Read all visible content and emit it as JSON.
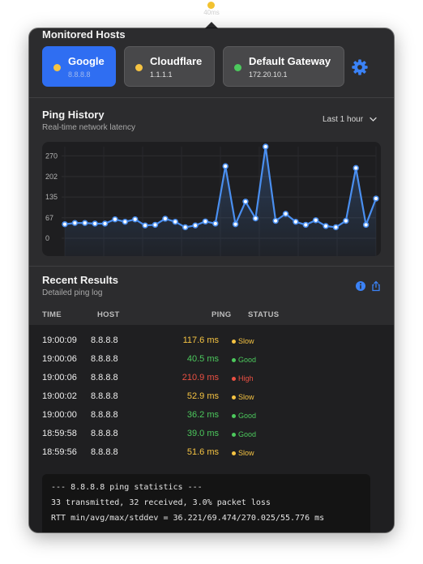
{
  "menubar": {
    "status_text": "40ms",
    "dot_color": "#f2c230"
  },
  "colors": {
    "accent": "#2f6ef2",
    "good": "#4cc95d",
    "slow": "#f5c342",
    "high": "#ec5043",
    "line": "#4a8ff0"
  },
  "hosts": {
    "title": "Monitored Hosts",
    "items": [
      {
        "name": "Google",
        "ip": "8.8.8.8",
        "status": "slow"
      },
      {
        "name": "Cloudflare",
        "ip": "1.1.1.1",
        "status": "slow"
      },
      {
        "name": "Default Gateway",
        "ip": "172.20.10.1",
        "status": "good"
      }
    ],
    "settings_icon": "gear-icon"
  },
  "history": {
    "title": "Ping History",
    "subtitle": "Real-time network latency",
    "range_label": "Last 1 hour",
    "range_icon": "chevron-down-icon"
  },
  "chart_data": {
    "type": "line",
    "title": "Ping History",
    "ylabel": "",
    "xlabel": "",
    "ylim": [
      0,
      300
    ],
    "y_ticks": [
      0,
      67,
      135,
      202,
      270
    ],
    "grid": true,
    "legend": "none",
    "series": [
      {
        "values": [
          46,
          50,
          50,
          48,
          48,
          62,
          54,
          62,
          42,
          44,
          64,
          54,
          36,
          42,
          55,
          48,
          236,
          46,
          120,
          65,
          300,
          57,
          80,
          54,
          44,
          59,
          40,
          36,
          57,
          230,
          44,
          130
        ]
      }
    ]
  },
  "results": {
    "title": "Recent Results",
    "subtitle": "Detailed ping log",
    "info_icon": "info-icon",
    "share_icon": "share-icon",
    "columns": {
      "time": "TIME",
      "host": "HOST",
      "ping": "PING",
      "status": "STATUS"
    },
    "rows": [
      {
        "time": "19:00:09",
        "host": "8.8.8.8",
        "ping": "117.6 ms",
        "status": "Slow",
        "level": "slow"
      },
      {
        "time": "19:00:06",
        "host": "8.8.8.8",
        "ping": "40.5 ms",
        "status": "Good",
        "level": "good"
      },
      {
        "time": "19:00:06",
        "host": "8.8.8.8",
        "ping": "210.9 ms",
        "status": "High",
        "level": "high"
      },
      {
        "time": "19:00:02",
        "host": "8.8.8.8",
        "ping": "52.9 ms",
        "status": "Slow",
        "level": "slow"
      },
      {
        "time": "19:00:00",
        "host": "8.8.8.8",
        "ping": "36.2 ms",
        "status": "Good",
        "level": "good"
      },
      {
        "time": "18:59:58",
        "host": "8.8.8.8",
        "ping": "39.0 ms",
        "status": "Good",
        "level": "good"
      },
      {
        "time": "18:59:56",
        "host": "8.8.8.8",
        "ping": "51.6 ms",
        "status": "Slow",
        "level": "slow"
      }
    ]
  },
  "terminal": {
    "lines": [
      "--- 8.8.8.8 ping statistics ---",
      "33 transmitted, 32 received, 3.0% packet loss",
      "RTT min/avg/max/stddev = 36.221/69.474/270.025/55.776 ms"
    ]
  }
}
